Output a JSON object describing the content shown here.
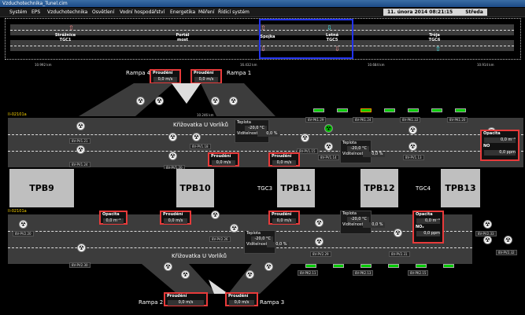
{
  "window": {
    "title": "Vzduchotechnika_Tunel.cim"
  },
  "menu": [
    "Systém",
    "EPS",
    "Vzduchotechnika",
    "Osvětlení",
    "Vodní hospodářství",
    "Energetika",
    "Měření",
    "Řídicí systém"
  ],
  "datetime": {
    "date": "11. února 2014  08:21:15",
    "day": "Středa"
  },
  "overview": {
    "labels": [
      "Strážnice TGC1",
      "Portál most",
      "Spojka",
      "Letná TGC5",
      "Trója TGC6"
    ],
    "km": [
      "10.992 km",
      "16.432 km",
      "10.684 km",
      "10.914 km"
    ]
  },
  "tunnels": {
    "north": "II-02101a",
    "south": "II-02101a"
  },
  "ramps": {
    "r1": "Rampa 1",
    "r2": "Rampa 2",
    "r3": "Rampa 3",
    "r4": "Rampa 4"
  },
  "crossings": {
    "top": "Křižovatka U Vorlíků",
    "bottom": "Křižovatka U Vorlíků",
    "km": "10.246 km"
  },
  "flow_panels": {
    "title": "Proudění",
    "value": "0,0",
    "unit": "m/s"
  },
  "temp_panels": {
    "t_label": "Teplota",
    "t_value": "-20,0 °C",
    "v_label": "Viditelnost",
    "v_value": "0,0 %"
  },
  "opacity_panels": {
    "title": "Opacita",
    "op_value": "0,0 m⁻¹",
    "no_label": "NO",
    "no_value": "0,0 ppm",
    "no2_label": "NO₂",
    "no2_value": "0,0 ppm"
  },
  "zones": {
    "tpb9": "TPB9",
    "tpb10": "TPB10",
    "tgc3": "TGC3",
    "tpb11": "TPB11",
    "tpb12": "TPB12",
    "tgc4": "TGC4",
    "tpb13": "TPB13"
  },
  "fans_top": [
    "8V-PV1.21",
    "8V-PV1.24",
    "8V-PV1.20",
    "8V-PV1.18",
    "8V-PV1.15",
    "8V-PV1.14",
    "8V-PV1.13"
  ],
  "fans_bottom": [
    "8V-PV2.20",
    "8V-PV2.26",
    "8V-PV2.30",
    "8V-PV2.29",
    "8V-PV2.31",
    "8V-PV2.33",
    "8V-PV2.32"
  ],
  "pk_top": [
    "8V-PK1.30",
    "8V-PK1.29",
    "8V-PK1.25",
    "8V-PK1.24",
    "8V-PK1.23",
    "8V-PK1.22",
    "8V-PK1.21",
    "8V-PK1.20"
  ],
  "pk_bottom": [
    "8V-PK2.11",
    "8V-PK2.12",
    "8V-PK2.13",
    "8V-PK2.14",
    "8V-PK2.15",
    "8V-PK2.16",
    "8V-PK2.17"
  ],
  "colors": {
    "road": "#3c3c3c",
    "panel_border": "#e83a3a",
    "zone": "#bfbfbf",
    "fan_ok": "#00cc00"
  }
}
